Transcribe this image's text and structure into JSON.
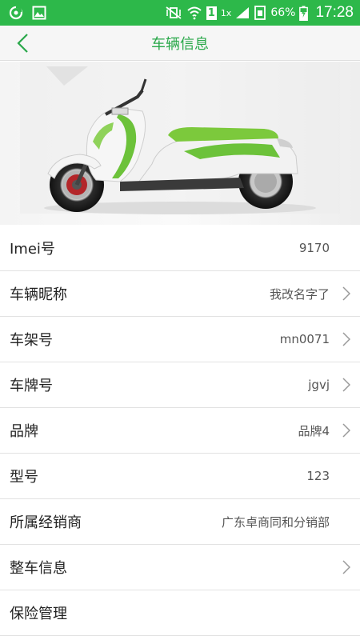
{
  "status_bar": {
    "network_label": "1x",
    "sim_label": "1",
    "battery": "66%",
    "time": "17:28",
    "accent_color": "#2db84a"
  },
  "header": {
    "title": "车辆信息",
    "title_color": "#2aa84a"
  },
  "hero": {
    "image": "scooter-photo"
  },
  "rows": [
    {
      "label": "Imei号",
      "value": "9170",
      "chevron": false
    },
    {
      "label": "车辆昵称",
      "value": "我改名字了",
      "chevron": true
    },
    {
      "label": "车架号",
      "value": "mn0071",
      "chevron": true
    },
    {
      "label": "车牌号",
      "value": "jgvj",
      "chevron": true
    },
    {
      "label": "品牌",
      "value": "品牌4",
      "chevron": true
    },
    {
      "label": "型号",
      "value": "123",
      "chevron": false
    },
    {
      "label": "所属经销商",
      "value": "广东卓商同和分销部",
      "chevron": false
    },
    {
      "label": "整车信息",
      "value": "",
      "chevron": true
    },
    {
      "label": "保险管理",
      "value": "",
      "chevron": false
    }
  ]
}
